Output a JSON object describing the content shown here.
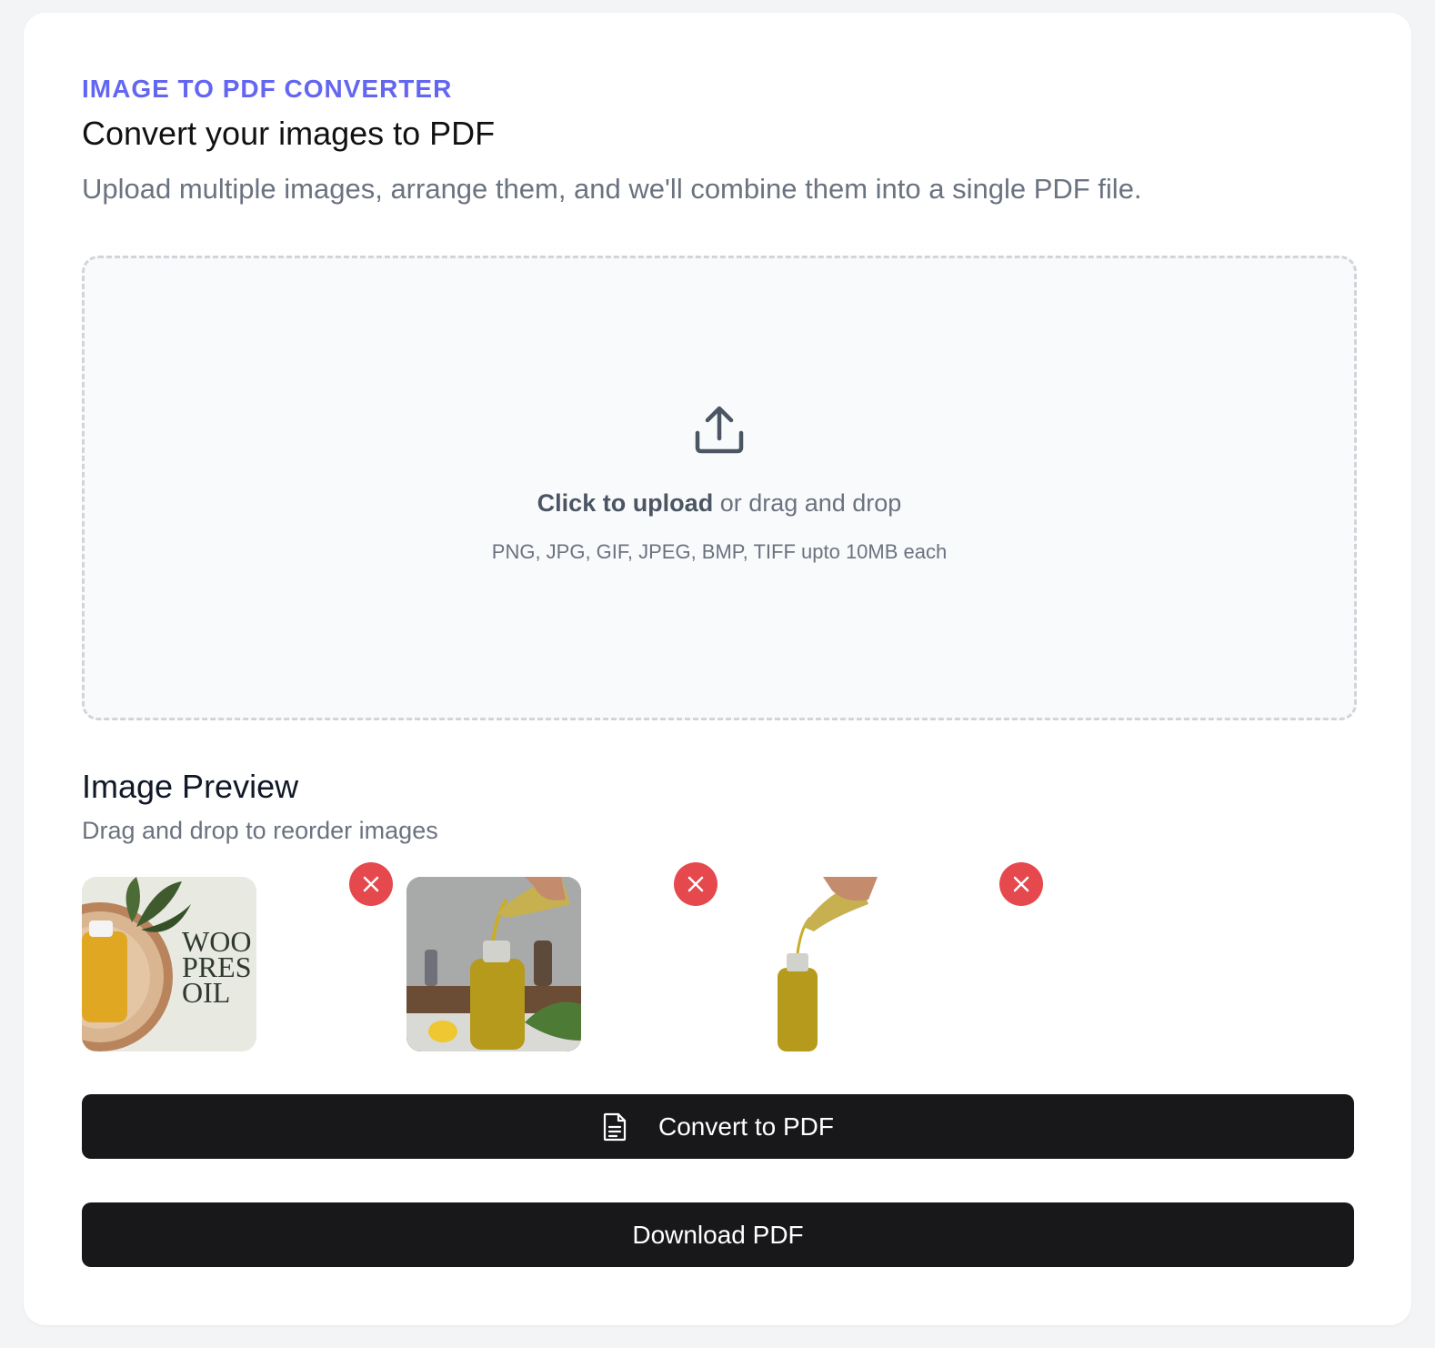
{
  "header": {
    "eyebrow": "IMAGE TO PDF CONVERTER",
    "title": "Convert your images to PDF",
    "subtitle": "Upload multiple images, arrange them, and we'll combine them into a single PDF file."
  },
  "dropzone": {
    "icon": "upload-icon",
    "cta_bold": "Click to upload",
    "cta_rest": " or drag and drop",
    "formats": "PNG, JPG, GIF, JPEG, BMP, TIFF upto 10MB each"
  },
  "preview": {
    "title": "Image Preview",
    "subtitle": "Drag and drop to reorder images",
    "images": [
      {
        "name": "wood-pressed-oil-image",
        "text_lines": [
          "WOO",
          "PRES",
          "OIL"
        ]
      },
      {
        "name": "oil-pouring-kitchen-image"
      },
      {
        "name": "oil-pouring-white-bg-image"
      }
    ]
  },
  "actions": {
    "convert_label": "Convert to PDF",
    "convert_icon": "document-icon",
    "download_label": "Download PDF"
  },
  "colors": {
    "accent": "#6366f1",
    "remove": "#e5484d",
    "button": "#18181b"
  }
}
